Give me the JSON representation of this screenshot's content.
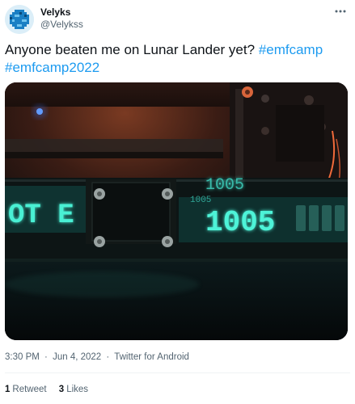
{
  "author": {
    "display_name": "Velyks",
    "handle": "@Velykss",
    "avatar_icon": "pixel-planet-avatar"
  },
  "more_icon": "more-options-icon",
  "tweet": {
    "text": "Anyone beaten me on Lunar Lander yet?",
    "hashtags": [
      "#emfcamp",
      "#emfcamp2022"
    ]
  },
  "media": {
    "display_left": "OT E",
    "display_right": "1005",
    "reflection_top": "1005",
    "reflection_small": "1005"
  },
  "meta": {
    "time": "3:30 PM",
    "separator": "·",
    "date": "Jun 4, 2022",
    "source": "Twitter for Android"
  },
  "stats": {
    "retweets_count": "1",
    "retweets_label": "Retweet",
    "likes_count": "3",
    "likes_label": "Likes"
  },
  "colors": {
    "hashtag": "#1d9bf0",
    "vfd_glow": "#3fe0c8",
    "muted": "#536471"
  }
}
